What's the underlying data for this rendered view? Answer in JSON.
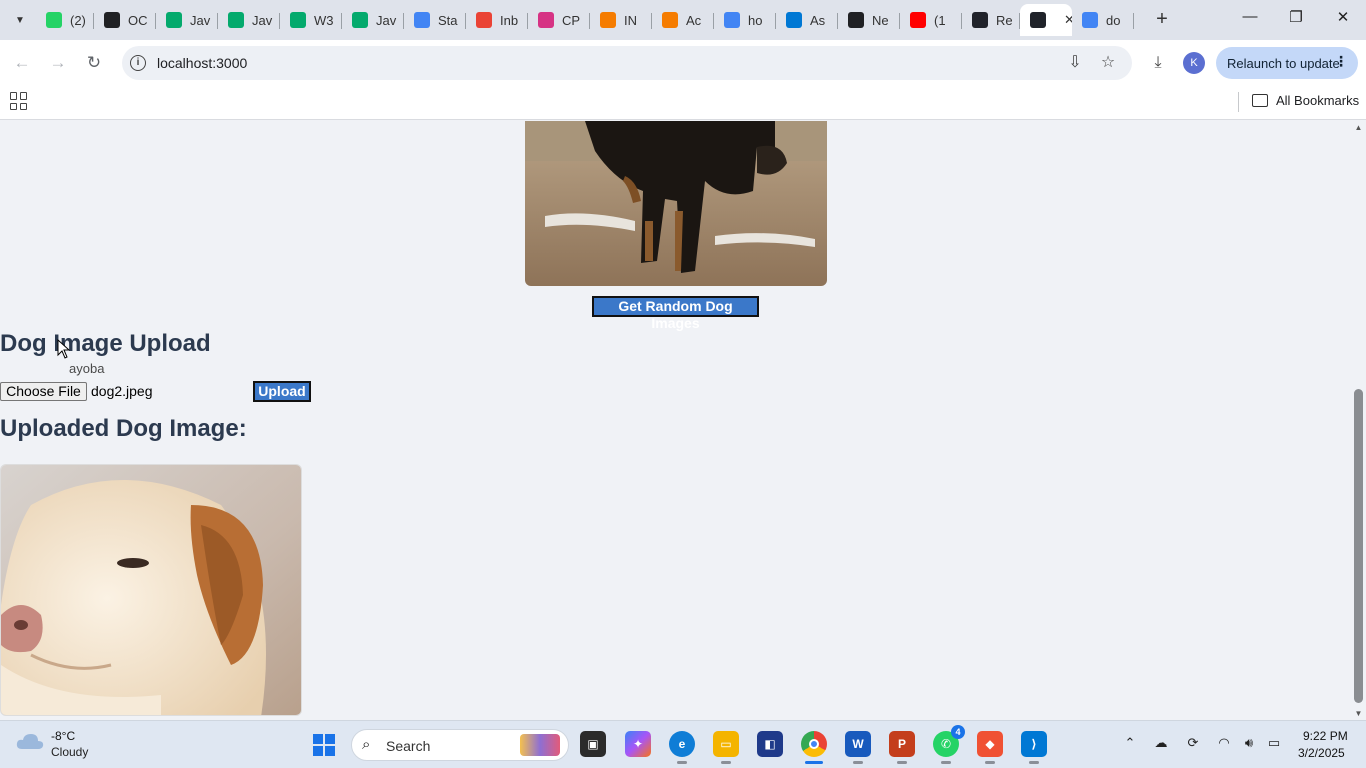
{
  "browser": {
    "tabs": [
      {
        "label": "(2)",
        "icon": "whatsapp-icon",
        "color": "#25d366"
      },
      {
        "label": "OC",
        "icon": "openai-icon",
        "color": "#202124"
      },
      {
        "label": "Jav",
        "icon": "w3schools-icon",
        "color": "#04aa6d"
      },
      {
        "label": "Jav",
        "icon": "w3schools-icon",
        "color": "#04aa6d"
      },
      {
        "label": "W3",
        "icon": "w3schools-icon",
        "color": "#04aa6d"
      },
      {
        "label": "Jav",
        "icon": "w3schools-icon",
        "color": "#04aa6d"
      },
      {
        "label": "Sta",
        "icon": "google-docs-icon",
        "color": "#4285f4"
      },
      {
        "label": "Inb",
        "icon": "gmail-icon",
        "color": "#ea4335"
      },
      {
        "label": "CP",
        "icon": "canva-icon",
        "color": "#d63384"
      },
      {
        "label": "IN",
        "icon": "orange-app-icon",
        "color": "#f57c00"
      },
      {
        "label": "Ac",
        "icon": "orange-app-icon",
        "color": "#f57c00"
      },
      {
        "label": "ho",
        "icon": "google-icon",
        "color": "#4285f4"
      },
      {
        "label": "As",
        "icon": "azure-icon",
        "color": "#0078d4"
      },
      {
        "label": "Ne",
        "icon": "github-icon",
        "color": "#202124"
      },
      {
        "label": "(1",
        "icon": "youtube-icon",
        "color": "#ff0000"
      },
      {
        "label": "Re",
        "icon": "react-icon",
        "color": "#20232a"
      },
      {
        "label": "",
        "icon": "react-icon",
        "color": "#20232a",
        "active": true
      },
      {
        "label": "do",
        "icon": "google-icon",
        "color": "#4285f4"
      }
    ],
    "url": "localhost:3000",
    "relaunch_label": "Relaunch to update",
    "avatar_letter": "K",
    "bookmarks_label": "All Bookmarks"
  },
  "page": {
    "random_button_label": "Get Random Dog Images",
    "upload_title": "Dog Image Upload",
    "watermark_text": "ayoba",
    "choose_file_label": "Choose File",
    "file_name": "dog2.jpeg",
    "upload_button_label": "Upload",
    "uploaded_title": "Uploaded Dog Image:"
  },
  "taskbar": {
    "temperature": "-8°C",
    "condition": "Cloudy",
    "search_label": "Search",
    "whatsapp_badge": "4",
    "time": "9:22 PM",
    "date": "3/2/2025"
  },
  "colors": {
    "button_blue": "#3b78c9",
    "heading": "#2c3a4f",
    "page_bg": "#f0f2f6"
  }
}
